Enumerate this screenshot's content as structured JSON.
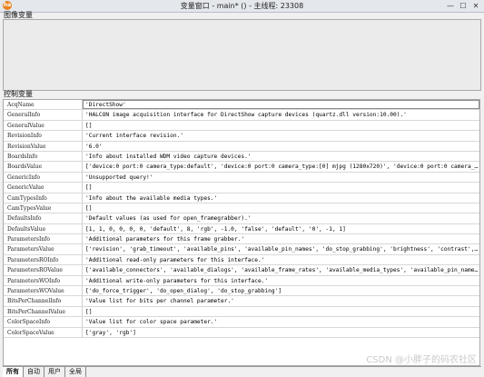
{
  "window": {
    "title": "变量窗口 - main* () - 主线程: 23308",
    "icon_text": "ha",
    "buttons": [
      "—",
      "☐",
      "✕"
    ]
  },
  "image_vars": {
    "label": "图像变量"
  },
  "control_vars": {
    "label": "控制变量",
    "rows": [
      {
        "name": "AcqName",
        "value": "'DirectShow'"
      },
      {
        "name": "GeneralInfo",
        "value": "'HALCON image acquisition interface for DirectShow capture devices (quartz.dll version:10.00).'"
      },
      {
        "name": "GeneralValue",
        "value": "[]"
      },
      {
        "name": "RevisionInfo",
        "value": "'Current interface revision.'"
      },
      {
        "name": "RevisionValue",
        "value": "'6.0'"
      },
      {
        "name": "BoardsInfo",
        "value": "'Info about installed WDM video capture devices.'"
      },
      {
        "name": "BoardsValue",
        "value": "['device:0 port:0 camera_type:default', 'device:0 port:0 camera_type:[0] mjpg (1280x720)', 'device:0 port:0 camera_type:..."
      },
      {
        "name": "GenericInfo",
        "value": "'Unsupported query!'"
      },
      {
        "name": "GenericValue",
        "value": "[]"
      },
      {
        "name": "CamTypesInfo",
        "value": "'Info about the available media types.'"
      },
      {
        "name": "CamTypesValue",
        "value": "[]"
      },
      {
        "name": "DefaultsInfo",
        "value": "'Default values (as used for open_framegrabber).'"
      },
      {
        "name": "DefaultsValue",
        "value": "[1, 1, 0, 0, 0, 0, 'default', 8, 'rgb', -1.0, 'false', 'default', '0', -1, 1]"
      },
      {
        "name": "ParametersInfo",
        "value": "'Additional parameters for this frame grabber.'"
      },
      {
        "name": "ParametersValue",
        "value": "['revision', 'grab_timeout', 'available_pins', 'available_pin_names', 'do_stop_grabbing', 'brightness', 'contrast', 'hue..."
      },
      {
        "name": "ParametersROInfo",
        "value": "'Additional read-only parameters for this interface.'"
      },
      {
        "name": "ParametersROValue",
        "value": "['available_connectors', 'available_dialogs', 'available_frame_rates', 'available_media_types', 'available_pin_names', '..."
      },
      {
        "name": "ParametersWOInfo",
        "value": "'Additional write-only parameters for this interface.'"
      },
      {
        "name": "ParametersWOValue",
        "value": "['do_force_trigger', 'do_open_dialog', 'do_stop_grabbing']"
      },
      {
        "name": "BitsPerChannelInfo",
        "value": "'Value list for bits per channel parameter.'"
      },
      {
        "name": "BitsPerChannelValue",
        "value": "[]"
      },
      {
        "name": "ColorSpaceInfo",
        "value": "'Value list for color space parameter.'"
      },
      {
        "name": "ColorSpaceValue",
        "value": "['gray', 'rgb']"
      }
    ]
  },
  "tabs": [
    {
      "label": "所有",
      "active": true
    },
    {
      "label": "自动"
    },
    {
      "label": "用户"
    },
    {
      "label": "全局"
    }
  ],
  "watermark": "CSDN @小胖子的码农社区"
}
